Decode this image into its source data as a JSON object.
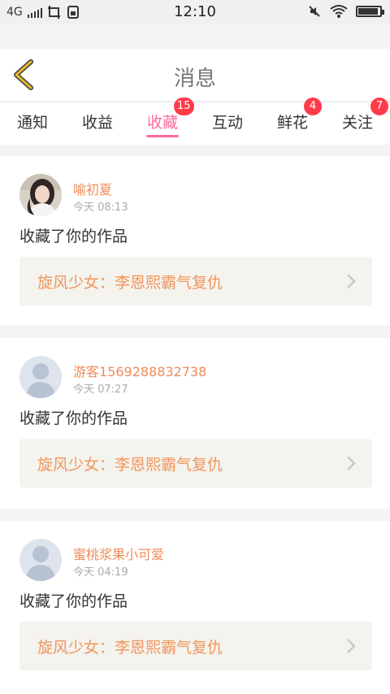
{
  "status_bar": {
    "network": "4G",
    "time": "12:10"
  },
  "header": {
    "title": "消息"
  },
  "tabs": [
    {
      "label": "通知",
      "badge": ""
    },
    {
      "label": "收益",
      "badge": ""
    },
    {
      "label": "收藏",
      "badge": "15",
      "active": true
    },
    {
      "label": "互动",
      "badge": ""
    },
    {
      "label": "鲜花",
      "badge": "4"
    },
    {
      "label": "关注",
      "badge": "7"
    }
  ],
  "messages": [
    {
      "user": "喻初夏",
      "time": "今天 08:13",
      "action": "收藏了你的作品",
      "work": "旋风少女：李恩熙霸气复仇",
      "avatar": "photo"
    },
    {
      "user": "游客1569288832738",
      "time": "今天 07:27",
      "action": "收藏了你的作品",
      "work": "旋风少女：李恩熙霸气复仇",
      "avatar": "default"
    },
    {
      "user": "蜜桃浆果小可爱",
      "time": "今天 04:19",
      "action": "收藏了你的作品",
      "work": "旋风少女：李恩熙霸气复仇",
      "avatar": "default"
    }
  ],
  "colors": {
    "accent": "#ff6aa0",
    "badge": "#ff3b4a",
    "username": "#f08b57",
    "back_arrow": "#e8b830"
  }
}
